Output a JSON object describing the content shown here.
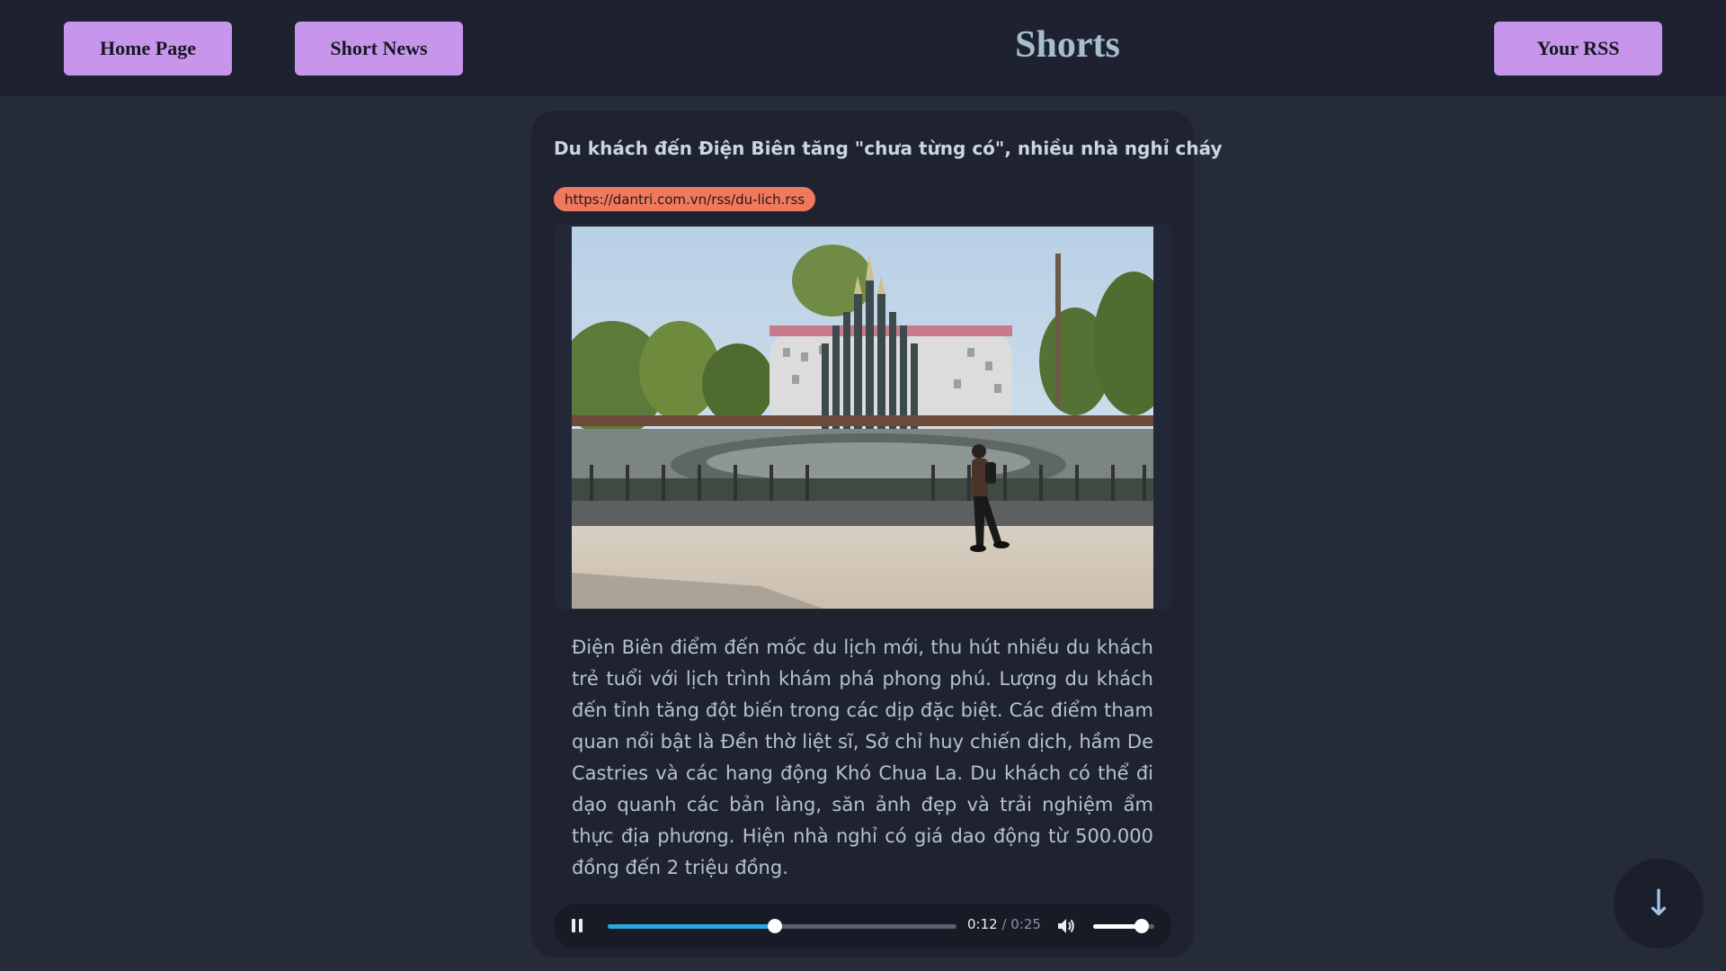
{
  "header": {
    "home_label": "Home Page",
    "short_news_label": "Short News",
    "title": "Shorts",
    "rss_label": "Your RSS"
  },
  "article": {
    "title": "Du khách đến Điện Biên tăng \"chưa từng có\", nhiều nhà nghỉ cháy",
    "source_url": "https://dantri.com.vn/rss/du-lich.rss",
    "image_icon": "photo-memorial-fountain",
    "summary": "Điện Biên điểm đến mốc du lịch mới, thu hút nhiều du khách trẻ tuổi với lịch trình khám phá phong phú. Lượng du khách đến tỉnh tăng đột biến trong các dịp đặc biệt. Các điểm tham quan nổi bật là Đền thờ liệt sĩ, Sở chỉ huy chiến dịch, hầm De Castries và các hang động Khó Chua La. Du khách có thể đi dạo quanh các bản làng, săn ảnh đẹp và trải nghiệm ẩm thực địa phương. Hiện nhà nghỉ có giá dao động từ 500.000 đồng đến 2 triệu đồng."
  },
  "player": {
    "current_time": "0:12",
    "separator": " / ",
    "duration": "0:25",
    "progress_fraction": 0.48,
    "volume_fraction": 0.8,
    "pause_icon": "pause-icon",
    "volume_icon": "volume-icon"
  },
  "scroll_button": {
    "glyph": "↓",
    "icon": "arrow-down-icon"
  },
  "colors": {
    "background": "#262b38",
    "topbar": "#1e2230",
    "nav_button": "#c795ec",
    "badge": "#f0785f",
    "progress": "#2aa8e0"
  }
}
